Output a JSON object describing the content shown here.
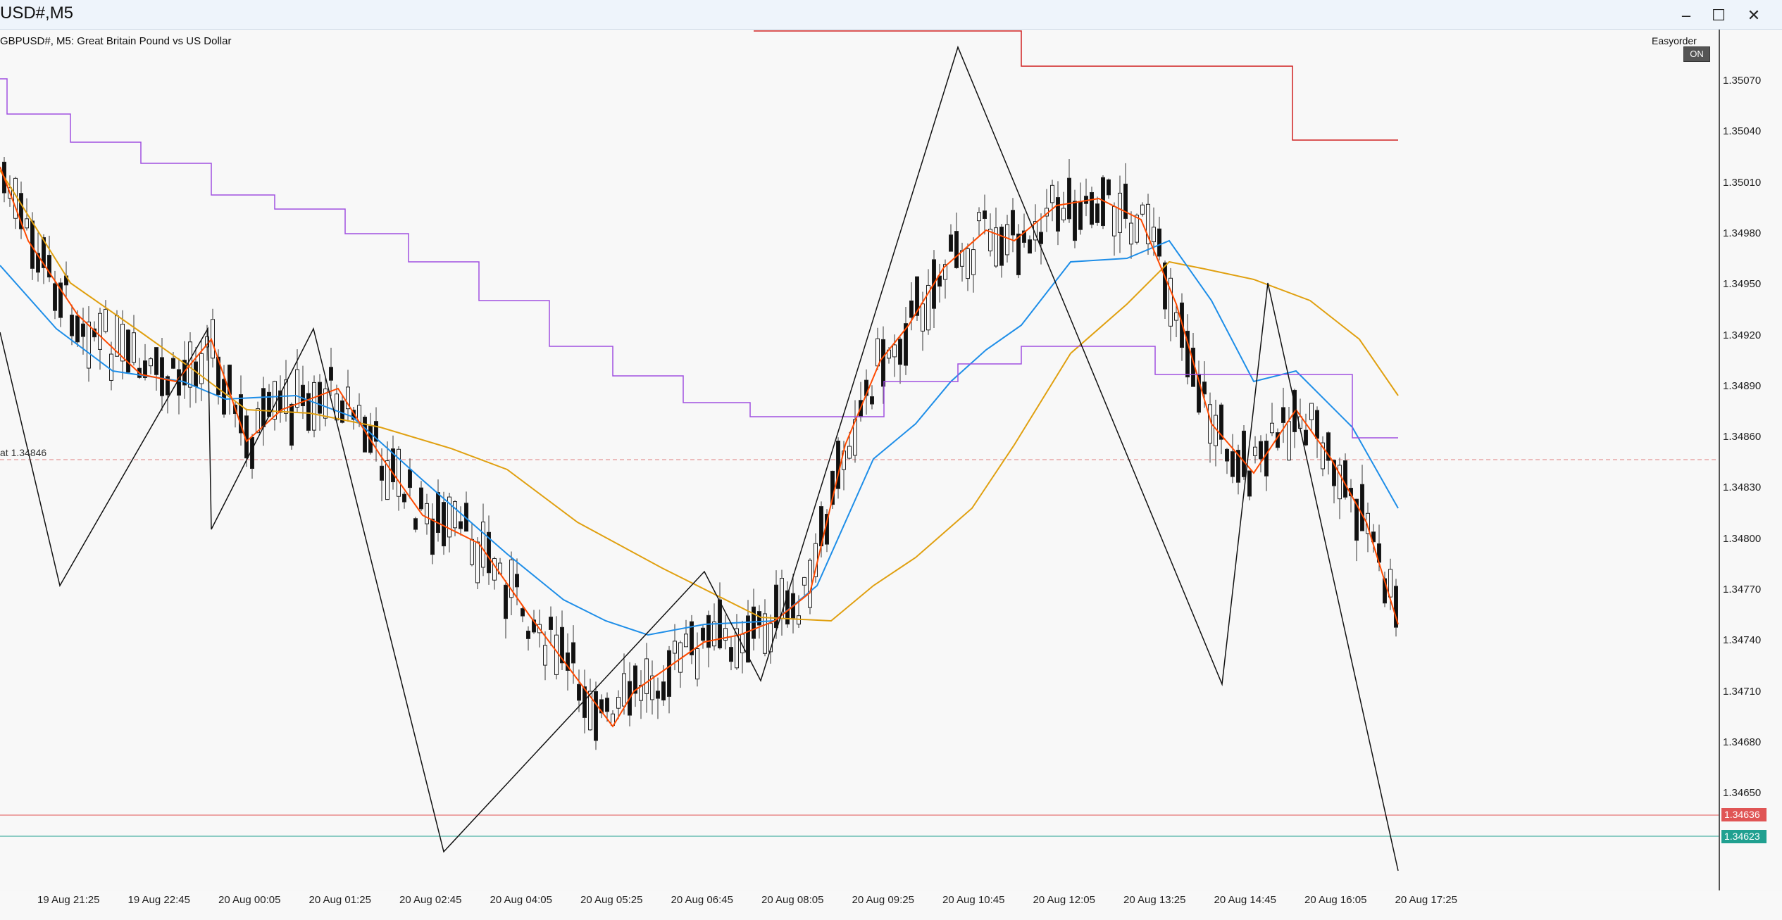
{
  "window": {
    "title": "USD#,M5",
    "minimize_glyph": "–",
    "maximize_glyph": "☐",
    "close_glyph": "✕"
  },
  "chart": {
    "symbol_label": "GBPUSD#, M5:  Great Britain Pound vs US Dollar",
    "bid_label": "at 1.34846",
    "easyorder_label": "Easyorder",
    "easyorder_toggle": "ON"
  },
  "price_axis": {
    "ticks": [
      "1.35070",
      "1.35040",
      "1.35010",
      "1.34980",
      "1.34950",
      "1.34920",
      "1.34890",
      "1.34860",
      "1.34830",
      "1.34800",
      "1.34770",
      "1.34740",
      "1.34710",
      "1.34680",
      "1.34650"
    ],
    "ask_tag": "1.34636",
    "bid_tag": "1.34623",
    "ask_color": "#e05555",
    "bid_color": "#20a090"
  },
  "time_axis": {
    "ticks": [
      "19 Aug 21:25",
      "19 Aug 22:45",
      "20 Aug 00:05",
      "20 Aug 01:25",
      "20 Aug 02:45",
      "20 Aug 04:05",
      "20 Aug 05:25",
      "20 Aug 06:45",
      "20 Aug 08:05",
      "20 Aug 09:25",
      "20 Aug 10:45",
      "20 Aug 12:05",
      "20 Aug 13:25",
      "20 Aug 14:45",
      "20 Aug 16:05",
      "20 Aug 17:25"
    ]
  },
  "colors": {
    "ema_fast": "#ff4a00",
    "ema_mid": "#1e8ee8",
    "ema_slow": "#e0a010",
    "step_purple": "#a050e0",
    "step_red": "#d02020",
    "zigzag": "#111111"
  }
}
